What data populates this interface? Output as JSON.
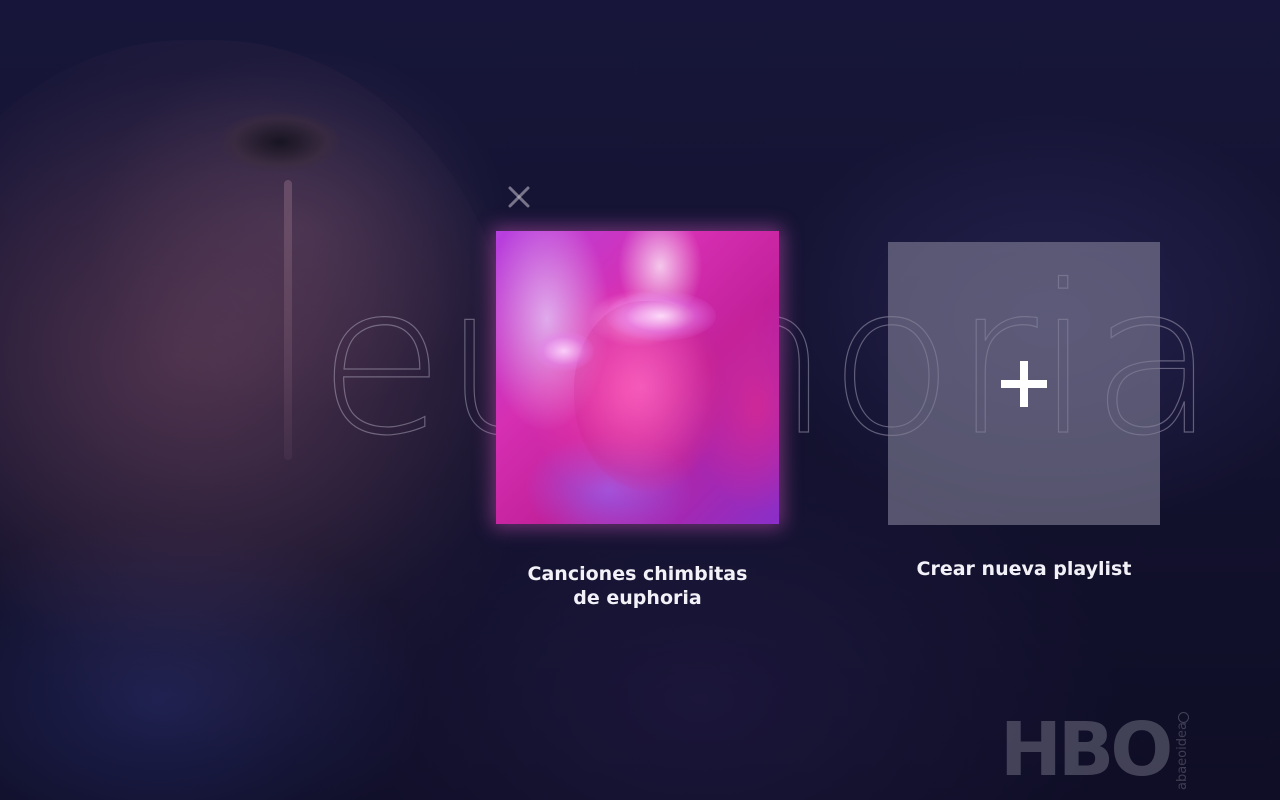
{
  "background": {
    "wordmark": "euphoria"
  },
  "close_button": {
    "icon": "close-icon"
  },
  "playlists": [
    {
      "title_line1": "Canciones chimbitas",
      "title_line2": "de euphoria"
    }
  ],
  "create_playlist": {
    "icon": "plus-icon",
    "label": "Crear nueva playlist"
  },
  "branding": {
    "network": "HBO",
    "watermark": "abaeoidea"
  },
  "colors": {
    "background": "#141331",
    "cover_glow": "#e05ac8",
    "tile": "#807e94",
    "text": "#f3f1f8"
  }
}
